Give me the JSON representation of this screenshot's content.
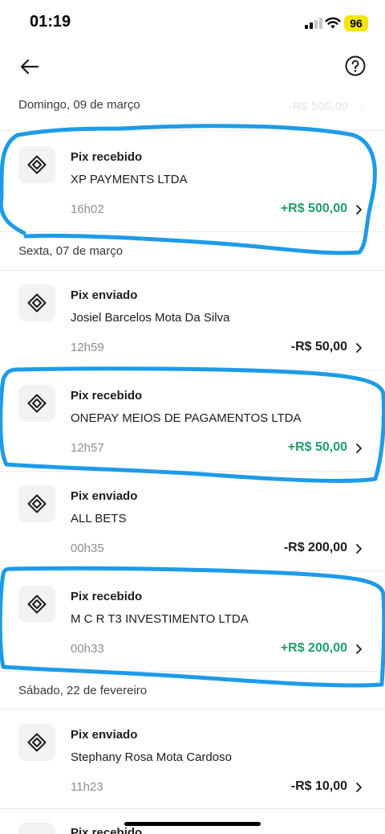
{
  "status_bar": {
    "time": "01:19",
    "battery": "96"
  },
  "sections": [
    {
      "date": "Domingo, 09 de março",
      "ghost_amount": "-R$ 500,00"
    },
    {
      "date": "Sexta, 07 de março"
    },
    {
      "date": "Sábado, 22 de fevereiro"
    }
  ],
  "transactions": [
    {
      "type": "Pix recebido",
      "name": "XP PAYMENTS LTDA",
      "time": "16h02",
      "amount": "+R$ 500,00",
      "direction": "in"
    },
    {
      "type": "Pix enviado",
      "name": "Josiel Barcelos Mota Da Silva",
      "time": "12h59",
      "amount": "-R$ 50,00",
      "direction": "out"
    },
    {
      "type": "Pix recebido",
      "name": "ONEPAY MEIOS DE PAGAMENTOS LTDA",
      "time": "12h57",
      "amount": "+R$ 50,00",
      "direction": "in"
    },
    {
      "type": "Pix enviado",
      "name": "ALL BETS",
      "time": "00h35",
      "amount": "-R$ 200,00",
      "direction": "out"
    },
    {
      "type": "Pix recebido",
      "name": "M C R T3 INVESTIMENTO LTDA",
      "time": "00h33",
      "amount": "+R$ 200,00",
      "direction": "in"
    },
    {
      "type": "Pix enviado",
      "name": "Stephany Rosa Mota Cardoso",
      "time": "11h23",
      "amount": "-R$ 10,00",
      "direction": "out"
    },
    {
      "type": "Pix recebido"
    }
  ],
  "icons": {
    "transaction": "pix-icon",
    "back": "arrow-left-icon",
    "help": "question-circle-icon",
    "chevron": "chevron-right-icon"
  },
  "colors": {
    "positive_amount": "#1f9d6c",
    "annotation_stroke": "#1e9be8",
    "battery_badge": "#f5e50d"
  }
}
